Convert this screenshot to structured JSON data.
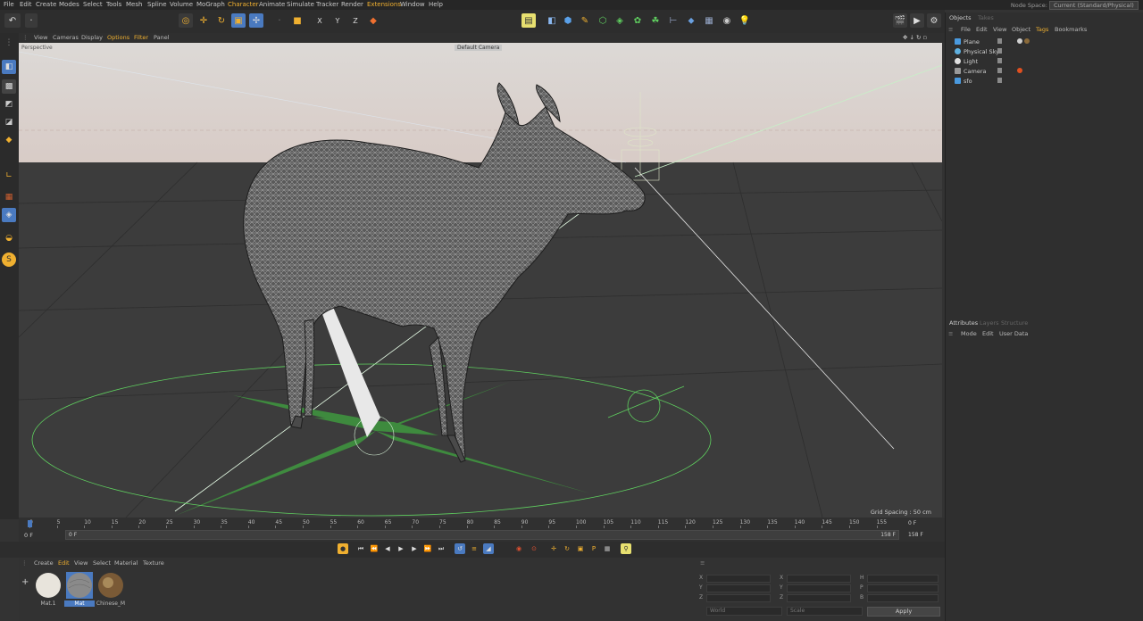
{
  "menu": [
    "File",
    "Edit",
    "Create",
    "Modes",
    "Select",
    "Tools",
    "Mesh",
    "Spline",
    "Volume",
    "MoGraph",
    "Character",
    "Animate",
    "Simulate",
    "Tracker",
    "Render",
    "Extensions",
    "Window",
    "Help"
  ],
  "node_space": {
    "label": "Node Space:",
    "value": "Current (Standard/Physical)"
  },
  "viewport_menu": [
    "View",
    "Cameras",
    "Display",
    "Options",
    "Filter",
    "Panel"
  ],
  "viewport": {
    "name": "Perspective",
    "camera": "Default Camera",
    "grid_spacing": "Grid Spacing : 50 cm"
  },
  "timeline": {
    "ticks": [
      "0",
      "5",
      "10",
      "15",
      "20",
      "25",
      "30",
      "35",
      "40",
      "45",
      "50",
      "55",
      "60",
      "65",
      "70",
      "75",
      "80",
      "85",
      "90",
      "95",
      "100",
      "105",
      "110",
      "115",
      "120",
      "125",
      "130",
      "135",
      "140",
      "145",
      "150",
      "155"
    ],
    "start_field": "0 F",
    "current_field": "0 F",
    "end_field": "158 F",
    "right_field1": "158 F",
    "right_field2": "0 F"
  },
  "material_menu": [
    "Create",
    "Edit",
    "View",
    "Select",
    "Material",
    "Texture"
  ],
  "materials": [
    {
      "label": "Mat.1",
      "color": "#e8e4dc"
    },
    {
      "label": "Mat",
      "color": "#8a8a8a"
    },
    {
      "label": "Chinese_M",
      "color": "#7a5a36"
    }
  ],
  "coords": {
    "rows": [
      [
        "X",
        "X",
        "H"
      ],
      [
        "Y",
        "Y",
        "P"
      ],
      [
        "Z",
        "Z",
        "B"
      ]
    ],
    "mode1": "World",
    "mode2": "Scale",
    "apply": "Apply"
  },
  "objects_panel": {
    "title": "Objects",
    "tab2": "Takes",
    "menu": [
      "File",
      "Edit",
      "View",
      "Object",
      "Tags",
      "Bookmarks"
    ],
    "items": [
      {
        "name": "Plane",
        "icon_color": "#4a9adf"
      },
      {
        "name": "Physical Sky",
        "icon_color": "#5fb0e0"
      },
      {
        "name": "Light",
        "icon_color": "#e0e0e0"
      },
      {
        "name": "Camera",
        "icon_color": "#9a9a9a"
      },
      {
        "name": "sfo",
        "icon_color": "#4a9adf"
      }
    ]
  },
  "attributes_panel": {
    "title": "Attributes",
    "tab2": "Layers",
    "tab3": "Structure",
    "menu": [
      "Mode",
      "Edit",
      "User Data"
    ]
  },
  "colors": {
    "accent": "#f0b030",
    "selection": "#4a7ac0",
    "grid_green": "#5fd05f",
    "bg": "#333333"
  }
}
